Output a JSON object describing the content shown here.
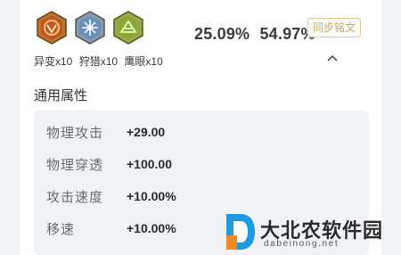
{
  "inscriptions": {
    "icons": [
      "mutation-inscription-icon",
      "hunt-inscription-icon",
      "hawkeye-inscription-icon"
    ],
    "labels": [
      "异变x10",
      "狩猎x10",
      "鹰眼x10"
    ],
    "percent_a": "25.09%",
    "percent_b": "54.97%",
    "sync_button": "同步铭文"
  },
  "attributes": {
    "title": "通用属性",
    "rows": [
      {
        "name": "物理攻击",
        "value": "+29.00"
      },
      {
        "name": "物理穿透",
        "value": "+100.00"
      },
      {
        "name": "攻击速度",
        "value": "+10.00%"
      },
      {
        "name": "移速",
        "value": "+10.00%"
      }
    ]
  },
  "watermark": {
    "brand": "大北农软件园",
    "domain": "dabeinong.net"
  },
  "colors": {
    "accent_gold": "#c9a66a",
    "gem_red": "#c0552b",
    "gem_blue": "#6a8fb8",
    "gem_green": "#8aa83a"
  }
}
